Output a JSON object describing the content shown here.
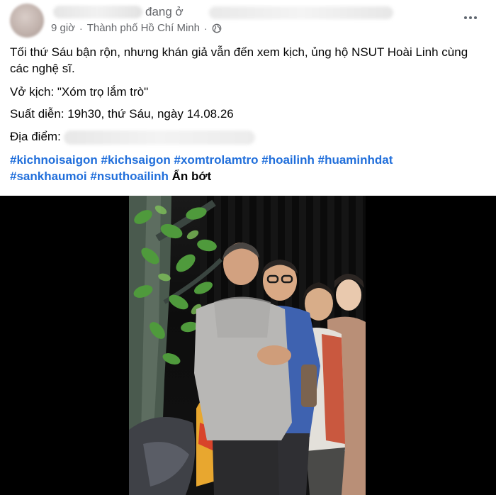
{
  "header": {
    "name_suffix": "đang ở",
    "time": "9 giờ",
    "separator": "·",
    "location": "Thành phố Hồ Chí Minh",
    "privacy_icon": "globe-icon",
    "more_icon": "more-horizontal-icon"
  },
  "post": {
    "paragraph1": "Tối thứ Sáu bận rộn, nhưng khán giả vẫn đến xem kịch, ủng hộ NSUT Hoài Linh cùng các nghệ sĩ.",
    "paragraph2": "Vở kịch: \"Xóm trọ lắm trò\"",
    "paragraph3": "Suất diễn: 19h30, thứ Sáu, ngày 14.08.26",
    "paragraph4_label": "Địa điểm:",
    "hashtags": [
      "#kichnoisaigon",
      "#kichsaigon",
      "#xomtrolamtro",
      "#hoailinh",
      "#huaminhdat",
      "#sankhaumoi",
      "#nsuthoailinh"
    ],
    "see_less": "Ẩn bớt"
  },
  "colors": {
    "link": "#216fdb",
    "secondary_text": "#65676b",
    "primary_text": "#050505"
  }
}
